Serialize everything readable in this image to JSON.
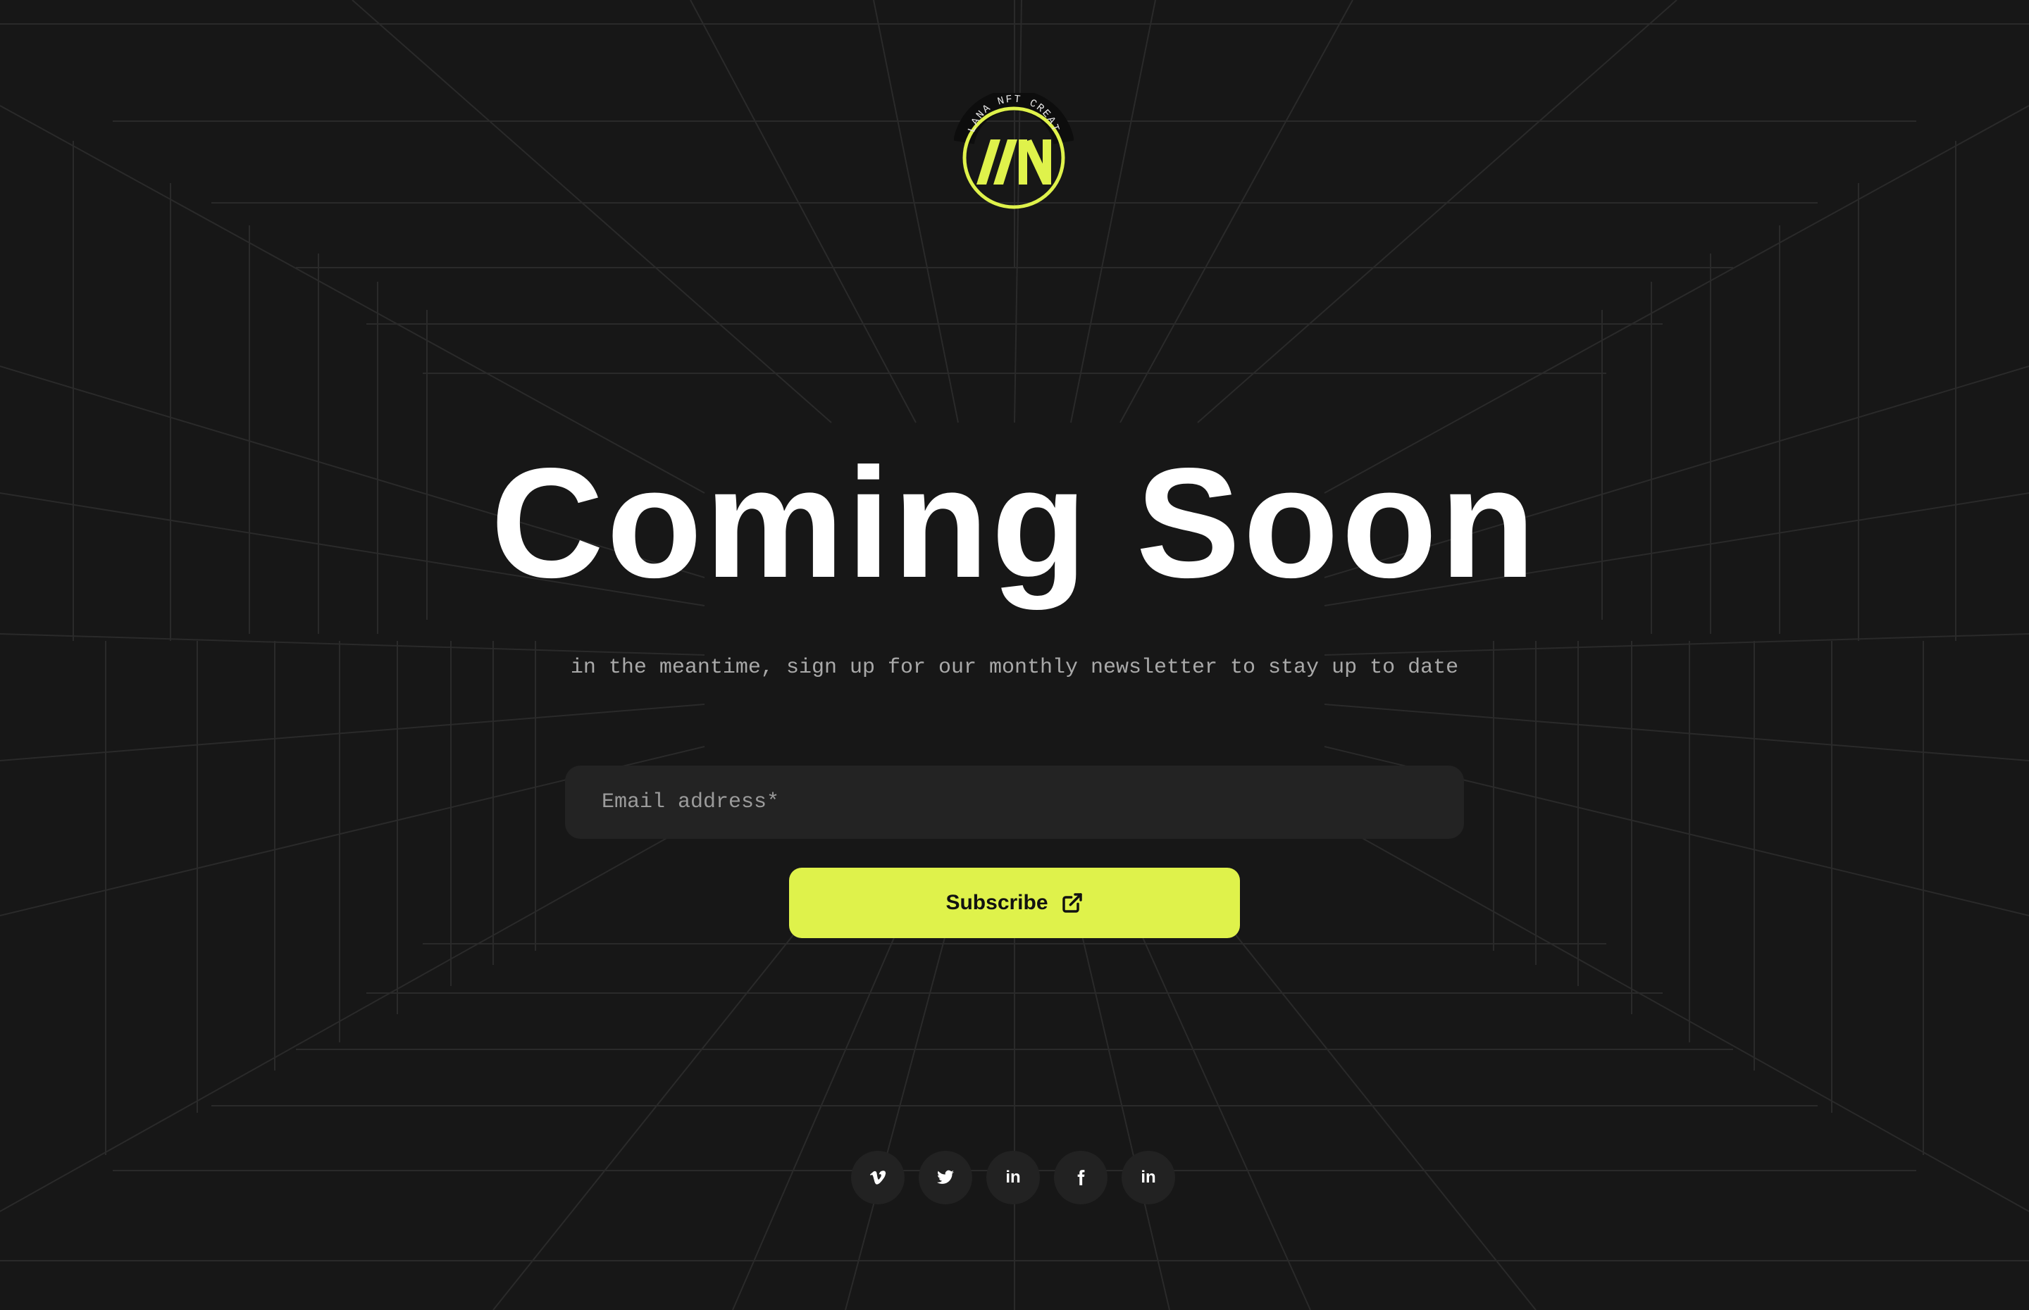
{
  "logo": {
    "ring_text": "SOLANA NFT CREATOR",
    "monogram": "AN",
    "accent_color": "#dff24b"
  },
  "hero": {
    "title": "Coming Soon",
    "subtitle": "in the meantime, sign up for our monthly newsletter to stay up to date"
  },
  "newsletter": {
    "email_placeholder": "Email address*",
    "email_value": "",
    "subscribe_label": "Subscribe",
    "subscribe_icon": "external-link-icon"
  },
  "socials": [
    {
      "name": "vimeo",
      "icon": "vimeo-icon"
    },
    {
      "name": "twitter",
      "icon": "twitter-icon"
    },
    {
      "name": "linkedin",
      "icon": "linkedin-icon",
      "label": "in"
    },
    {
      "name": "facebook",
      "icon": "facebook-icon"
    },
    {
      "name": "linkedin",
      "icon": "linkedin-icon",
      "label": "in"
    }
  ],
  "colors": {
    "background": "#171717",
    "accent": "#dff24b",
    "text_primary": "#ffffff",
    "text_secondary": "#a9a9a9",
    "input_background": "#232323",
    "social_background": "#222222"
  }
}
